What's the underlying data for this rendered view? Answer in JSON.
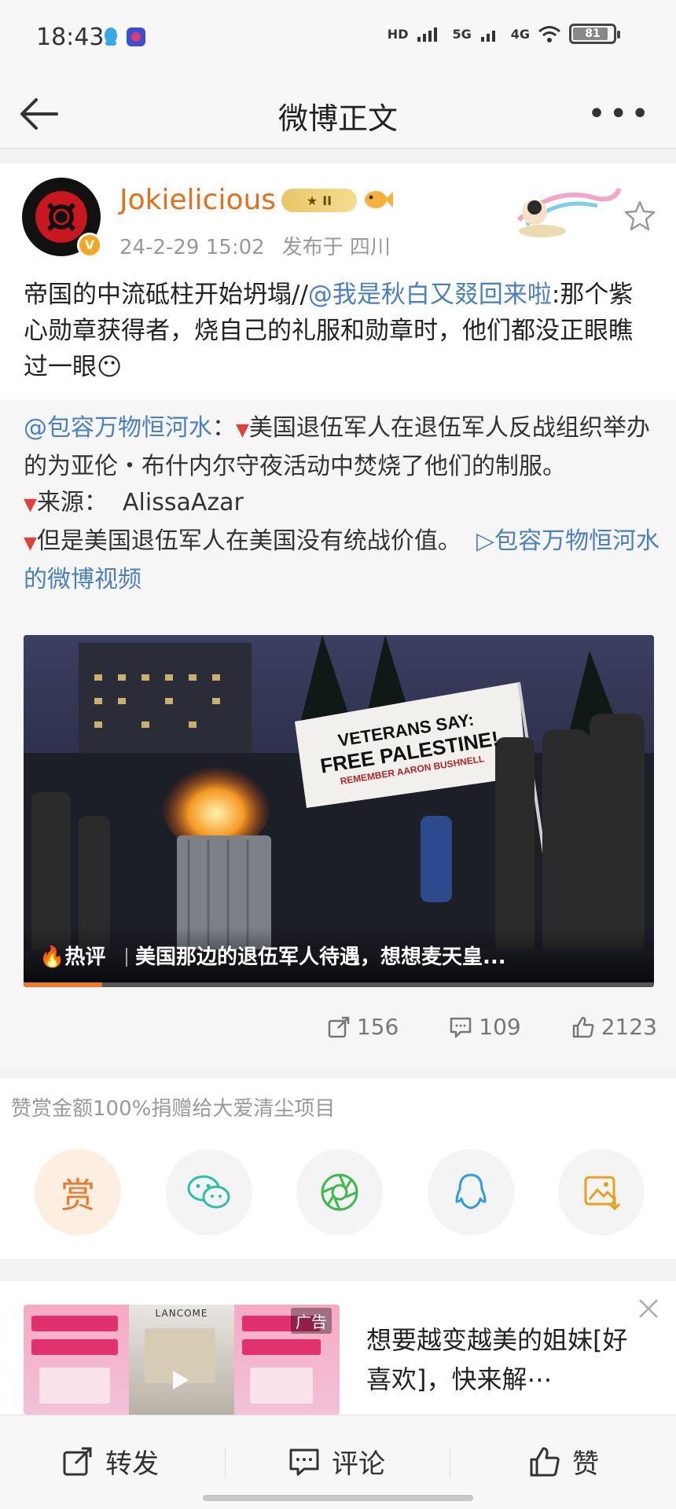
{
  "status_bar": {
    "time": "18:43",
    "network_hd": "HD",
    "network_5g": "5G",
    "network_4g": "4G",
    "battery": "81"
  },
  "nav": {
    "title": "微博正文",
    "back_icon": "back-arrow-icon",
    "more_icon": "more-dots-icon"
  },
  "post": {
    "username": "Jokielicious",
    "vip_level": "II",
    "date": "24-2-29 15:02",
    "location": "发布于 四川",
    "text_part1": "帝国的中流砥柱开始坍塌//",
    "mention": "@我是秋白又叕回来啦",
    "text_part2": ":那个紫心勋章获得者，烧自己的礼服和勋章时，他们都没正眼瞧过一眼",
    "emoji": "😶"
  },
  "repost": {
    "author": "@包容万物恒河水",
    "line1": "美国退伍军人在退伍军人反战组织举办的为亚伦・布什内尔守夜活动中焚烧了他们的制服。",
    "source_label": "来源：",
    "source_value": "AlissaAzar",
    "line3": "但是美国退伍军人在美国没有统战价值。",
    "video_link": "包容万物恒河水的微博视频",
    "video": {
      "hot_label": "热评",
      "hot_comment": "美国那边的退伍军人待遇，想想麦天皇...",
      "banner_line1": "VETERANS SAY:",
      "banner_line2": "FREE PALESTINE!",
      "banner_line3": "REMEMBER AARON BUSHNELL",
      "progress": 0.125
    },
    "actions": {
      "reposts": "156",
      "comments": "109",
      "likes": "2123"
    }
  },
  "reward": {
    "label": "赞赏金额100%捐赠给大爱清尘项目",
    "tip_char": "赏"
  },
  "ad": {
    "tag": "广告",
    "brand": "LANCOME",
    "text": "想要越变越美的姐妹[好喜欢]，快来解⋯"
  },
  "bottom_bar": {
    "repost": "转发",
    "comment": "评论",
    "like": "赞"
  },
  "colors": {
    "accent_orange": "#e4701c",
    "link_blue": "#4a7fc1",
    "marker_red": "#e0413a"
  }
}
